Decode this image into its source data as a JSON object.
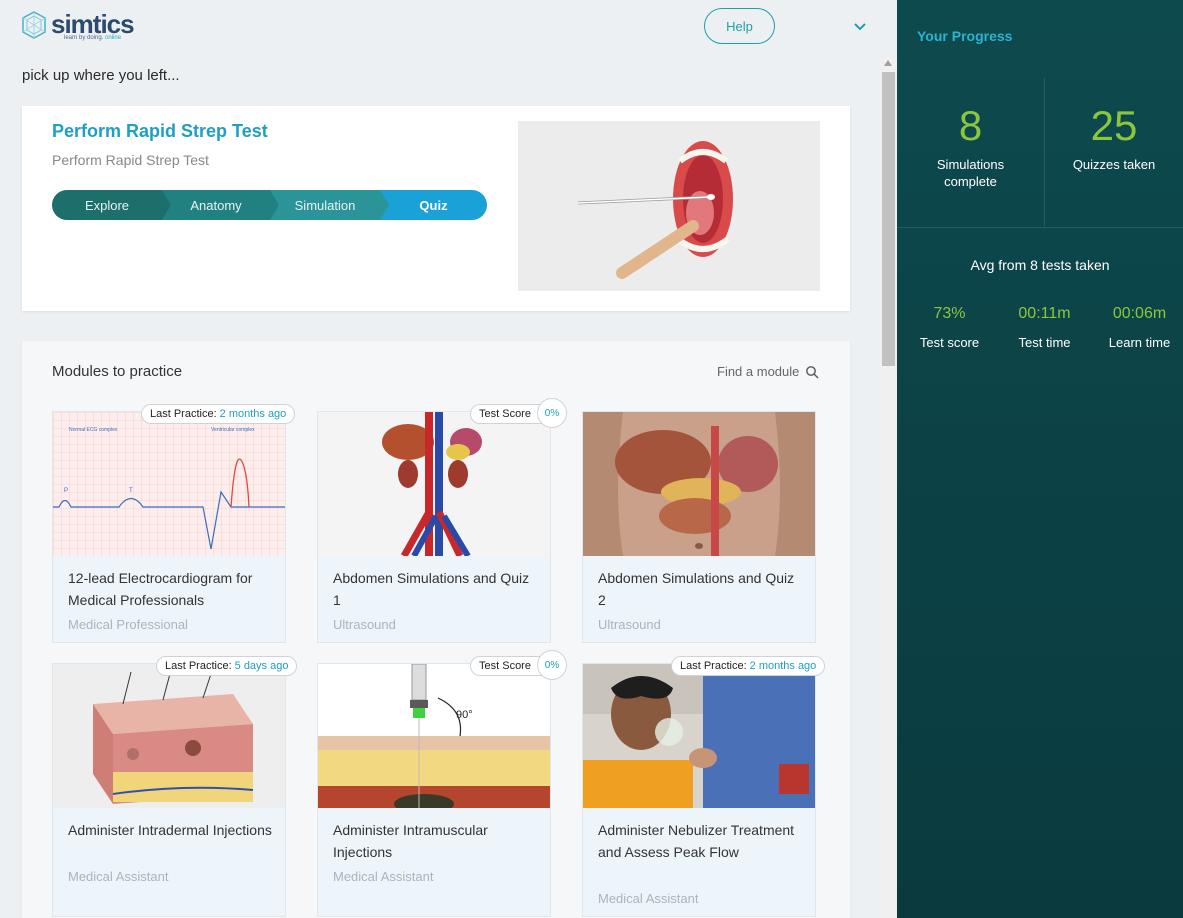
{
  "brand": {
    "name": "simtics",
    "tagline_prefix": "learn by doing.",
    "tagline_suffix": "online"
  },
  "header": {
    "help_label": "Help"
  },
  "resume": {
    "caption": "pick up where you left...",
    "title": "Perform Rapid Strep Test",
    "subtitle": "Perform Rapid Strep Test",
    "steps": [
      "Explore",
      "Anatomy",
      "Simulation",
      "Quiz"
    ],
    "active_step": "Quiz"
  },
  "modules": {
    "title": "Modules to practice",
    "find_label": "Find a module",
    "cards": [
      {
        "name": "12-lead Electrocardiogram for Medical Professionals",
        "category": "Medical Professional",
        "badge_label": "Last Practice:",
        "badge_value": "2 months ago"
      },
      {
        "name": "Abdomen Simulations and Quiz 1",
        "category": "Ultrasound",
        "badge_label": "Test Score",
        "badge_value": "0%"
      },
      {
        "name": "Abdomen Simulations and Quiz 2",
        "category": "Ultrasound"
      },
      {
        "name": "Administer Intradermal Injections",
        "category": "Medical Assistant",
        "badge_label": "Last Practice:",
        "badge_value": "5 days ago"
      },
      {
        "name": "Administer Intramuscular Injections",
        "category": "Medical Assistant",
        "badge_label": "Test Score",
        "badge_value": "0%"
      },
      {
        "name": "Administer Nebulizer Treatment and Assess Peak Flow",
        "category": "Medical Assistant",
        "badge_label": "Last Practice:",
        "badge_value": "2 months ago"
      }
    ],
    "ecg_labels": {
      "left": "Normal ECG complex",
      "right": "Ventricular complex",
      "p": "P",
      "t": "T"
    },
    "injection_angle": "90°"
  },
  "progress": {
    "title": "Your Progress",
    "simulations_complete": "8",
    "simulations_label": "Simulations complete",
    "quizzes_taken": "25",
    "quizzes_label": "Quizzes taken",
    "avg_title": "Avg from 8 tests taken",
    "metrics": [
      {
        "value": "73%",
        "label": "Test score"
      },
      {
        "value": "00:11m",
        "label": "Test time"
      },
      {
        "value": "00:06m",
        "label": "Learn time"
      }
    ]
  },
  "colors": {
    "accent": "#1e9fc4",
    "panel": "#0d4a4e",
    "stat_green": "#8cc63f"
  }
}
